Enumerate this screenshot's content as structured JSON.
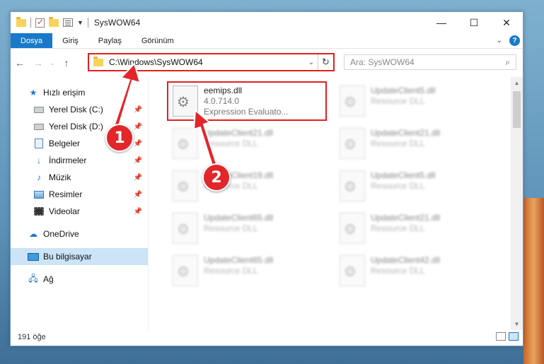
{
  "window": {
    "title": "SysWOW64",
    "controls": {
      "minimize": "—",
      "maximize": "☐",
      "close": "✕"
    }
  },
  "ribbon": {
    "tabs": [
      {
        "label": "Dosya",
        "active": true
      },
      {
        "label": "Giriş"
      },
      {
        "label": "Paylaş"
      },
      {
        "label": "Görünüm"
      }
    ],
    "help": "?"
  },
  "address": {
    "path": "C:\\Windows\\SysWOW64",
    "search_placeholder": "Ara: SysWOW64"
  },
  "nav": {
    "items": [
      {
        "label": "Hızlı erişim",
        "icon": "star-icon"
      },
      {
        "label": "Yerel Disk (C:)",
        "icon": "disk-icon",
        "pinned": true
      },
      {
        "label": "Yerel Disk (D:)",
        "icon": "disk-icon",
        "pinned": true
      },
      {
        "label": "Belgeler",
        "icon": "documents-icon",
        "pinned": true
      },
      {
        "label": "İndirmeler",
        "icon": "download-icon",
        "pinned": true
      },
      {
        "label": "Müzik",
        "icon": "music-icon",
        "pinned": true
      },
      {
        "label": "Resimler",
        "icon": "pictures-icon",
        "pinned": true
      },
      {
        "label": "Videolar",
        "icon": "video-icon",
        "pinned": true
      },
      {
        "label": "OneDrive",
        "icon": "cloud-icon"
      },
      {
        "label": "Bu bilgisayar",
        "icon": "computer-icon",
        "selected": true
      },
      {
        "label": "Ağ",
        "icon": "network-icon"
      }
    ]
  },
  "files": {
    "highlighted": {
      "name": "eemips.dll",
      "version": "4.0.714.0",
      "type": "Expression Evaluato..."
    },
    "blurred": [
      {
        "name": "UpdateClient5.dll",
        "type": "Resource DLL"
      },
      {
        "name": "UpdateClient21.dll",
        "type": "Resource DLL"
      },
      {
        "name": "UpdateClient21.dll",
        "type": "Resource DLL"
      },
      {
        "name": "UpdateClient19.dll",
        "type": "Resource DLL"
      },
      {
        "name": "UpdateClient5.dll",
        "type": "Resource DLL"
      },
      {
        "name": "UpdateClient65.dll",
        "type": "Resource DLL"
      },
      {
        "name": "UpdateClient21.dll",
        "type": "Resource DLL"
      },
      {
        "name": "UpdateClient65.dll",
        "type": "Resource DLL"
      },
      {
        "name": "UpdateClient42.dll",
        "type": "Resource DLL"
      }
    ]
  },
  "status": {
    "count": "191 öğe"
  },
  "annotations": {
    "step1": "1",
    "step2": "2",
    "color": "#e3262a"
  }
}
